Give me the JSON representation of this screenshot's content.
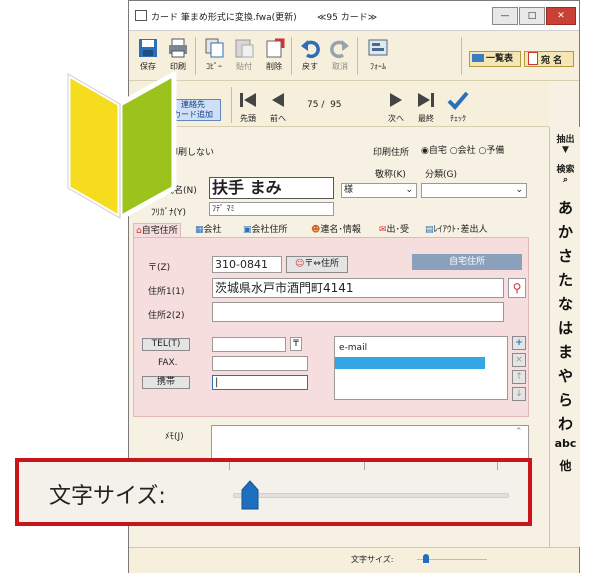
{
  "window": {
    "title": "カード 筆まめ形式に変換.fwa(更新)",
    "card_counter_title": "≪95 カード≫",
    "controls": [
      "—",
      "□",
      "✕"
    ]
  },
  "toolbar": {
    "items": [
      {
        "label": "保存",
        "icon": "save-icon"
      },
      {
        "label": "印刷",
        "icon": "print-icon"
      },
      {
        "label": "ｺﾋﾟｰ",
        "icon": "copy-icon"
      },
      {
        "label": "貼付",
        "icon": "paste-icon"
      },
      {
        "label": "削除",
        "icon": "delete-icon"
      },
      {
        "label": "戻す",
        "icon": "undo-icon"
      },
      {
        "label": "取消",
        "icon": "redo-icon"
      },
      {
        "label": "ﾌｫｰﾑ",
        "icon": "form-icon"
      }
    ],
    "list_button": "一覧表",
    "name_button": "宛 名"
  },
  "nav": {
    "add_contact_line1": "連絡先",
    "add_contact_line2": "カード追加",
    "first": "先頭",
    "prev": "前へ",
    "position": "75 /  95",
    "next": "次へ",
    "last": "最終",
    "check": "ﾁｪｯｸ"
  },
  "form": {
    "print_setting": "宛名印刷しない",
    "print_address_label": "印刷住所",
    "print_address_options": [
      "自宅",
      "会社",
      "予備"
    ],
    "print_address_selected": "自宅",
    "name_label": "氏名(N)",
    "name_value": "扶手 まみ",
    "honorific_label": "敬称(K)",
    "honorific_value": "様",
    "category_label": "分類(G)",
    "category_value": "",
    "furigana_label": "ﾌﾘｶﾞﾅ(Y)",
    "furigana_value": "ﾌﾃﾞ ﾏﾐ",
    "tabs": [
      "自宅住所",
      "会社",
      "会社住所",
      "連名･情報",
      "出･受",
      "ﾚｲｱｳﾄ･差出人"
    ],
    "zip_label": "〒(Z)",
    "zip_value": "310-0841",
    "zip_convert_button": "〒⇔住所",
    "home_address_badge": "自宅住所",
    "address1_label": "住所1(1)",
    "address1_value": "茨城県水戸市酒門町4141",
    "address2_label": "住所2(2)",
    "address2_value": "",
    "tel_label": "TEL(T)",
    "tel_value": "",
    "fax_label": "FAX.",
    "fax_value": "",
    "mobile_label": "携帯",
    "mobile_value": "",
    "email_label": "e-mail",
    "memo_label": "ﾒﾓ(J)",
    "memo_value": "",
    "side_buttons": [
      "+",
      "×",
      "↑",
      "↓"
    ]
  },
  "right_column": {
    "extract_label": "抽出",
    "search_label": "検索",
    "index": [
      "あ",
      "か",
      "さ",
      "た",
      "な",
      "は",
      "ま",
      "や",
      "ら",
      "わ",
      "abc",
      "他"
    ]
  },
  "status": {
    "text_size_label": "文字サイズ:",
    "text_size_level": 0.0
  },
  "overlay": {
    "text_size_label": "文字サイズ:",
    "text_size_level": 0.0
  },
  "colors": {
    "overlay_border": "#c8151b",
    "slider_thumb": "#1f6fc0",
    "panel_pink": "#f7dede",
    "mark_yellow": "#f6dc1e",
    "mark_green": "#9cc31c"
  }
}
